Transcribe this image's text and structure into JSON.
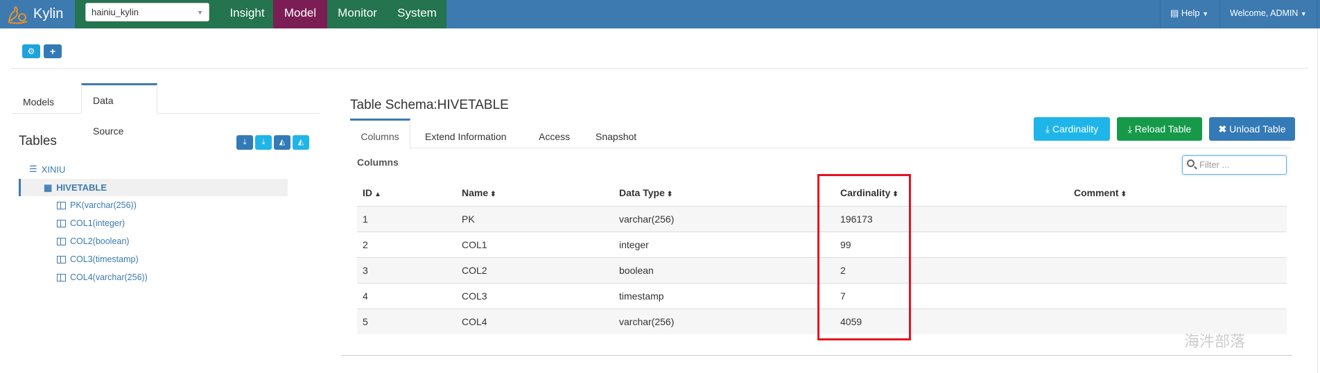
{
  "navbar": {
    "brand": "Kylin",
    "project_select": "hainiu_kylin",
    "tabs": [
      {
        "label": "Insight",
        "active": false
      },
      {
        "label": "Model",
        "active": true
      },
      {
        "label": "Monitor",
        "active": false
      },
      {
        "label": "System",
        "active": false
      }
    ],
    "help_label": "Help",
    "welcome_label": "Welcome, ADMIN",
    "colors": {
      "bar": "#3c7ab0",
      "tab": "#23744f",
      "active_tab": "#7b1e55"
    }
  },
  "toolbar": {
    "settings_icon": "gears-icon",
    "add_icon": "plus-icon",
    "add_label": "+"
  },
  "left_panel": {
    "tabs": [
      {
        "label": "Models",
        "active": false
      },
      {
        "label": "Data Source",
        "active": true
      }
    ],
    "tables_title": "Tables",
    "tool_buttons": [
      "download-icon",
      "download-icon",
      "area-chart-icon",
      "area-chart-icon"
    ],
    "tree": {
      "database": "XINIU",
      "table": "HIVETABLE",
      "columns": [
        "PK(varchar(256))",
        "COL1(integer)",
        "COL2(boolean)",
        "COL3(timestamp)",
        "COL4(varchar(256))"
      ]
    }
  },
  "main": {
    "title": "Table Schema:HIVETABLE",
    "tabs": [
      {
        "label": "Columns",
        "active": true
      },
      {
        "label": "Extend Information",
        "active": false
      },
      {
        "label": "Access",
        "active": false
      },
      {
        "label": "Snapshot",
        "active": false
      }
    ],
    "buttons": {
      "cardinality": "Cardinality",
      "reload": "Reload Table",
      "unload": "Unload Table"
    },
    "section_label": "Columns",
    "filter_placeholder": "Filter ...",
    "table": {
      "headers": [
        "ID",
        "Name",
        "Data Type",
        "Cardinality",
        "Comment"
      ],
      "rows": [
        [
          "1",
          "PK",
          "varchar(256)",
          "196173",
          ""
        ],
        [
          "2",
          "COL1",
          "integer",
          "99",
          ""
        ],
        [
          "3",
          "COL2",
          "boolean",
          "2",
          ""
        ],
        [
          "4",
          "COL3",
          "timestamp",
          "7",
          ""
        ],
        [
          "5",
          "COL4",
          "varchar(256)",
          "4059",
          ""
        ]
      ]
    },
    "highlight_color": "#e8101f"
  },
  "watermark": "海汼部落"
}
